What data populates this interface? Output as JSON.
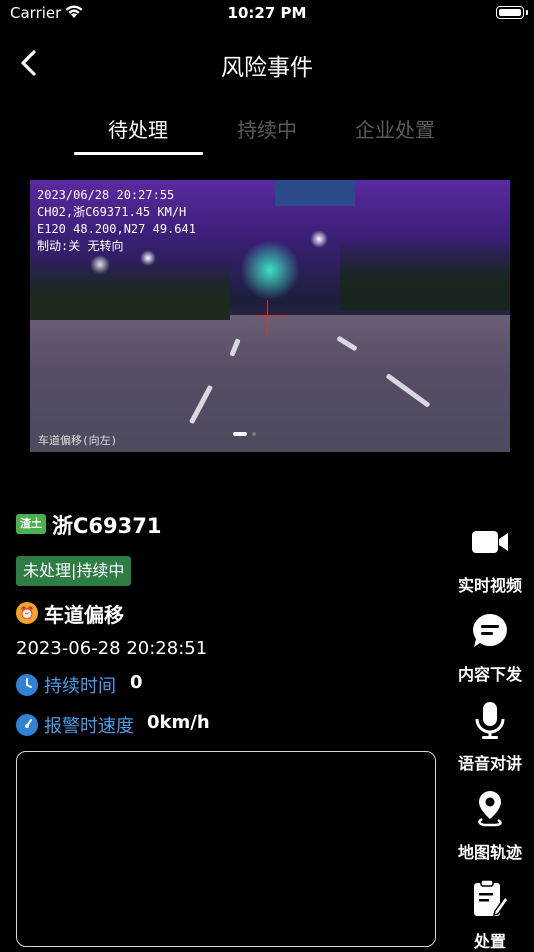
{
  "status_bar": {
    "carrier": "Carrier",
    "time": "10:27 PM"
  },
  "nav": {
    "title": "风险事件"
  },
  "tabs": [
    {
      "label": "待处理",
      "active": true
    },
    {
      "label": "持续中",
      "active": false
    },
    {
      "label": "企业处置",
      "active": false
    }
  ],
  "video": {
    "overlay_lines": [
      "2023/06/28 20:27:55",
      "CH02,浙C69371.45 KM/H",
      "E120 48.200,N27 49.641",
      "制动:关 无转向"
    ],
    "footer_text": "车道偏移(向左)"
  },
  "event": {
    "vehicle_type": "渣土",
    "plate": "浙C69371",
    "status": "未处理|持续中",
    "type": "车道偏移",
    "time": "2023-06-28 20:28:51",
    "duration_label": "持续时间",
    "duration_value": "0",
    "speed_label": "报警时速度",
    "speed_value": "0km/h"
  },
  "side_actions": [
    {
      "label": "实时视频",
      "icon": "video-camera-icon"
    },
    {
      "label": "内容下发",
      "icon": "message-icon"
    },
    {
      "label": "语音对讲",
      "icon": "microphone-icon"
    },
    {
      "label": "地图轨迹",
      "icon": "map-pin-icon"
    },
    {
      "label": "处置",
      "icon": "clipboard-edit-icon"
    }
  ],
  "colors": {
    "background": "#000000",
    "tab_inactive": "#5a5a5a",
    "status_badge": "#2e7d45",
    "vehicle_badge": "#4caf50",
    "accent_blue": "#4a9be8",
    "warning_orange": "#f5a623"
  }
}
